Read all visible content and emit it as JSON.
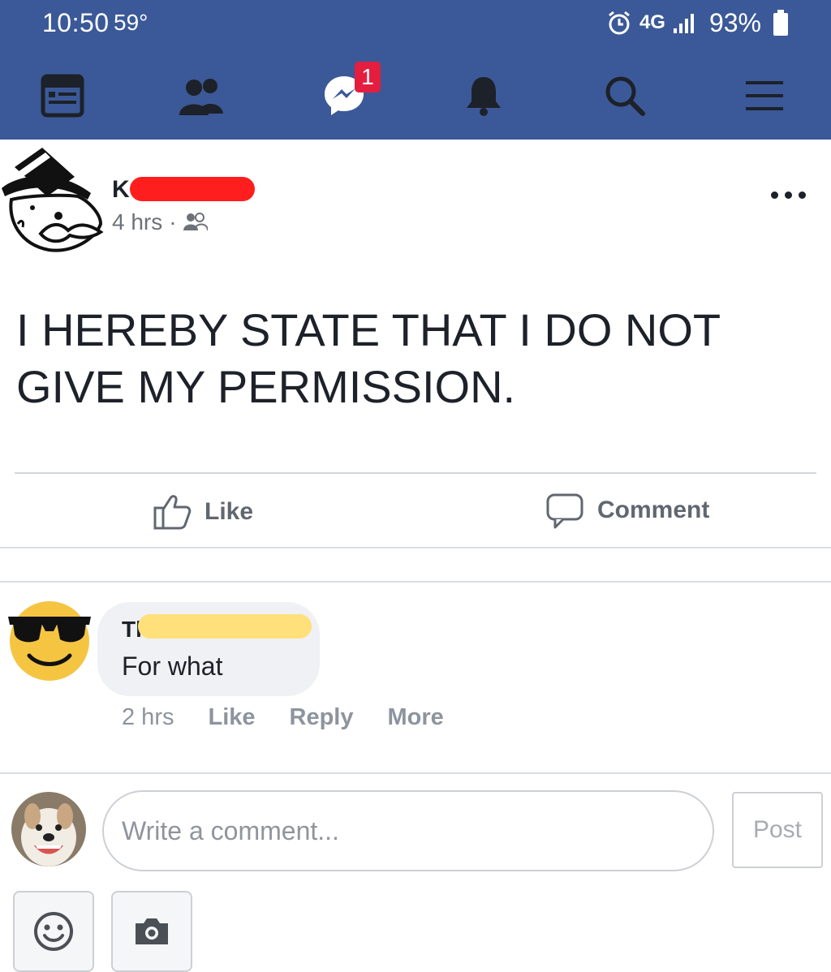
{
  "status_bar": {
    "time": "10:50",
    "temperature": "59°",
    "network": "4G",
    "battery": "93%"
  },
  "nav": {
    "messenger_badge": "1",
    "icons": [
      "news-feed-icon",
      "friends-icon",
      "messenger-icon",
      "notifications-icon",
      "search-icon",
      "menu-icon"
    ]
  },
  "post": {
    "author_initial": "K",
    "time": "4 hrs",
    "separator": "·",
    "text": "I HEREBY STATE THAT I DO NOT GIVE MY PERMISSION.",
    "like_label": "Like",
    "comment_label": "Comment"
  },
  "comment": {
    "author_initial": "Th",
    "text": "For what",
    "time": "2 hrs",
    "like_label": "Like",
    "reply_label": "Reply",
    "more_label": "More"
  },
  "composer": {
    "placeholder": "Write a comment...",
    "post_label": "Post"
  },
  "colors": {
    "brand": "#3b5998",
    "badge": "#e41e3f",
    "redact_red": "#ff1e1e",
    "redact_yellow": "#ffe07a"
  }
}
